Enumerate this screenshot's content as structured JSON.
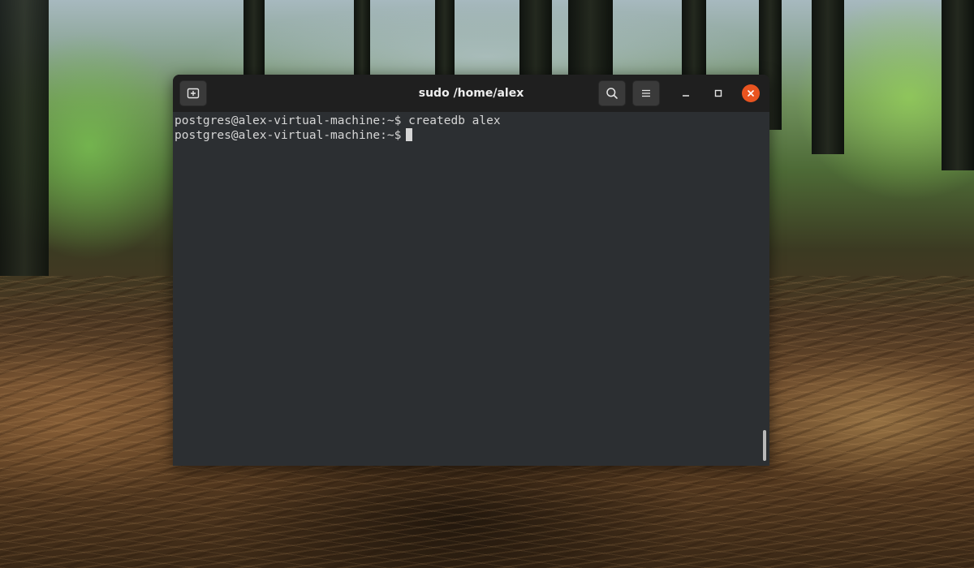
{
  "window": {
    "title": "sudo /home/alex"
  },
  "headerbar": {
    "new_tab_icon": "new-tab-icon",
    "search_icon": "search-icon",
    "menu_icon": "hamburger-menu-icon",
    "minimize_icon": "minimize-icon",
    "maximize_icon": "maximize-icon",
    "close_icon": "close-icon"
  },
  "terminal": {
    "lines": [
      {
        "prompt": "postgres@alex-virtual-machine:~$",
        "command": "createdb alex"
      },
      {
        "prompt": "postgres@alex-virtual-machine:~$",
        "command": ""
      }
    ]
  },
  "colors": {
    "terminal_bg": "#2c2f32",
    "headerbar_bg": "#1f1f1f",
    "close_button": "#e95420",
    "text": "#d6d6d6"
  }
}
